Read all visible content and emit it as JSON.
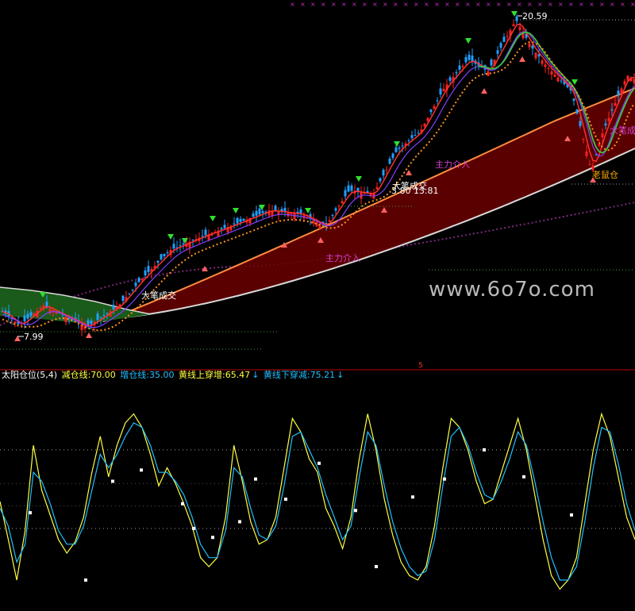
{
  "chart_data": [
    {
      "type": "candlestick",
      "panel": "price",
      "price_high_label": "20.59",
      "price_low_label": "7.99",
      "price_range": [
        7,
        21.5
      ],
      "annotations": [
        {
          "text": "大笔成交",
          "color": "#ffffff"
        },
        {
          "text": "大笔成交",
          "color": "#ffffff"
        },
        {
          "text": "主力介入",
          "color": "#d040d0"
        },
        {
          "text": "主力介入",
          "color": "#d040d0"
        },
        {
          "text": "老鼠仓",
          "color": "#ffb000"
        },
        {
          "text": "大笔成",
          "color": "#d040d0"
        },
        {
          "text": "3.80 13.81",
          "color": "#ffffff"
        }
      ],
      "colors": {
        "up": "#ff2020",
        "down": "#20a0ff",
        "band_fill": "#6a0000",
        "band_top": "#ff8c40",
        "band_bottom": "#d8d8d8",
        "ma_green": "#40c040"
      }
    },
    {
      "type": "line",
      "panel": "oscillator",
      "title": "太阳仓位(5,4)",
      "legend": [
        {
          "label": "减仓线:70.00",
          "color": "#ffff40"
        },
        {
          "label": "增仓线:35.00",
          "color": "#20c0ff"
        },
        {
          "label": "黄线上穿增:65.47",
          "color": "#ffff40"
        },
        {
          "label": "黄线下穿减:75.21",
          "color": "#20c0ff"
        }
      ],
      "ylim": [
        0,
        100
      ],
      "series": [
        {
          "color": "#ffff40",
          "values": [
            47,
            30,
            12,
            34,
            72,
            52,
            41,
            30,
            24,
            29,
            40,
            60,
            76,
            58,
            72,
            82,
            86,
            80,
            68,
            54,
            62,
            55,
            46,
            36,
            22,
            18,
            22,
            40,
            72,
            56,
            38,
            28,
            30,
            40,
            62,
            84,
            78,
            66,
            60,
            44,
            36,
            26,
            40,
            66,
            86,
            70,
            48,
            32,
            20,
            14,
            12,
            18,
            36,
            62,
            84,
            80,
            70,
            56,
            46,
            48,
            60,
            72,
            84,
            70,
            50,
            30,
            14,
            8,
            12,
            22,
            46,
            70,
            86,
            76,
            58,
            40,
            30
          ]
        },
        {
          "color": "#20c0ff",
          "values": [
            44,
            36,
            20,
            28,
            60,
            56,
            46,
            34,
            28,
            28,
            36,
            52,
            68,
            62,
            68,
            76,
            82,
            80,
            72,
            60,
            60,
            56,
            50,
            40,
            28,
            22,
            22,
            34,
            62,
            58,
            44,
            32,
            30,
            36,
            54,
            76,
            78,
            70,
            62,
            50,
            40,
            30,
            36,
            58,
            78,
            72,
            54,
            38,
            26,
            18,
            14,
            16,
            30,
            54,
            76,
            80,
            72,
            60,
            50,
            48,
            56,
            66,
            78,
            72,
            56,
            38,
            22,
            12,
            12,
            18,
            38,
            62,
            80,
            78,
            64,
            46,
            34
          ]
        }
      ],
      "markers_percent": [
        42,
        12,
        56,
        61,
        46,
        35,
        31,
        38,
        57,
        48,
        64,
        43,
        18,
        49,
        57,
        70,
        58,
        41
      ]
    }
  ],
  "oscillator_label_color": "#ffffff",
  "watermark": "www.6o7o.com",
  "scale_marker": "5"
}
